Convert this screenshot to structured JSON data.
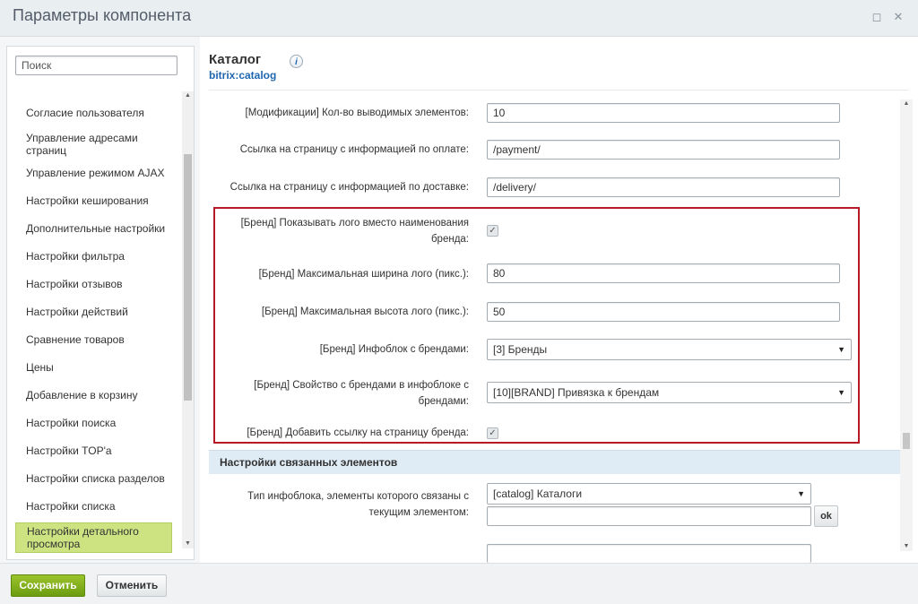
{
  "window": {
    "title": "Параметры компонента",
    "maximize_icon": "◻",
    "close_icon": "✕"
  },
  "sidebar": {
    "search_placeholder": "Поиск",
    "items": [
      {
        "label": "Согласие пользователя"
      },
      {
        "label": "Управление адресами страниц"
      },
      {
        "label": "Управление режимом AJAX"
      },
      {
        "label": "Настройки кеширования"
      },
      {
        "label": "Дополнительные настройки"
      },
      {
        "label": "Настройки фильтра"
      },
      {
        "label": "Настройки отзывов"
      },
      {
        "label": "Настройки действий"
      },
      {
        "label": "Сравнение товаров"
      },
      {
        "label": "Цены"
      },
      {
        "label": "Добавление в корзину"
      },
      {
        "label": "Настройки поиска"
      },
      {
        "label": "Настройки TOP'а"
      },
      {
        "label": "Настройки списка разделов"
      },
      {
        "label": "Настройки списка"
      },
      {
        "label": "Настройки детального просмотра",
        "active": true
      }
    ]
  },
  "main": {
    "title": "Каталог",
    "code": "bitrix:catalog",
    "info_icon": "i",
    "fields": {
      "offers_count": {
        "label": "[Модификации] Кол-во выводимых элементов:",
        "value": "10"
      },
      "payment_url": {
        "label": "Ссылка на страницу с информацией по оплате:",
        "value": "/payment/"
      },
      "delivery_url": {
        "label": "Ссылка на страницу с информацией по доставке:",
        "value": "/delivery/"
      },
      "brand_show_logo": {
        "label": "[Бренд] Показывать лого вместо наименования бренда:",
        "checked": true
      },
      "brand_logo_width": {
        "label": "[Бренд] Максимальная ширина лого (пикс.):",
        "value": "80"
      },
      "brand_logo_height": {
        "label": "[Бренд] Максимальная высота лого (пикс.):",
        "value": "50"
      },
      "brand_iblock": {
        "label": "[Бренд] Инфоблок с брендами:",
        "value": "[3] Бренды"
      },
      "brand_property": {
        "label": "[Бренд] Свойство с брендами в инфоблоке с брендами:",
        "value": "[10][BRAND] Привязка к брендам"
      },
      "brand_link": {
        "label": "[Бренд] Добавить ссылку на страницу бренда:",
        "checked": true
      }
    },
    "section_linked": "Настройки связанных элементов",
    "linked_type": {
      "label": "Тип инфоблока, элементы которого связаны с текущим элементом:",
      "value": "[catalog] Каталоги"
    },
    "ok_label": "ok"
  },
  "footer": {
    "save_label": "Сохранить",
    "cancel_label": "Отменить"
  },
  "colors": {
    "accent_green": "#7aab18",
    "highlight_border": "#b51a26",
    "link_blue": "#2067b0",
    "active_item": "#cde382"
  }
}
